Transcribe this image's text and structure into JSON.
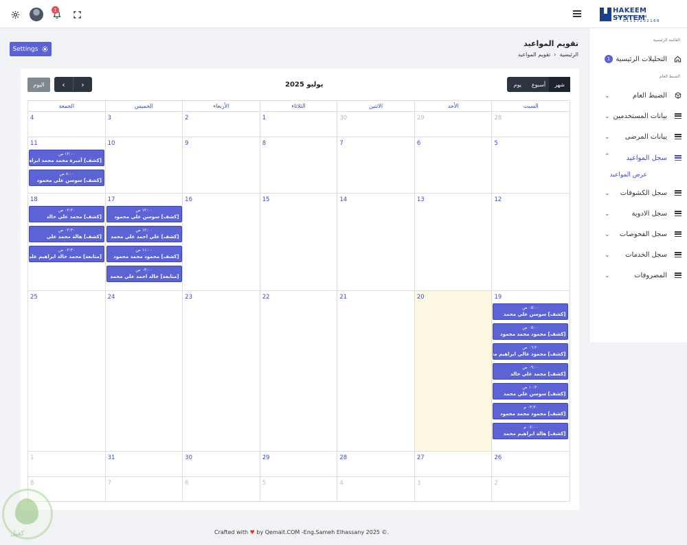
{
  "topbar": {
    "notif_count": "1",
    "logo_title": "HAKEEM SYSTEM",
    "logo_sub": "QEMAIT.COM",
    "logo_phone": "01117202166"
  },
  "sidebar": {
    "section_main": "القائمة الرئيسية",
    "dashboard_label": "التحليلات الرئيسية",
    "dashboard_badge": "1",
    "section_settings": "الضبط العام",
    "items": [
      {
        "label": "الضبط العام"
      },
      {
        "label": "بيانات المستخدمين"
      },
      {
        "label": "بيانات المرضى"
      },
      {
        "label": "سجل المواعيد"
      },
      {
        "label": "سجل الكشوفات"
      },
      {
        "label": "سجل الادوية"
      },
      {
        "label": "سجل الفحوصات"
      },
      {
        "label": "سجل الخدمات"
      },
      {
        "label": "المصروفات"
      }
    ],
    "sub_item": "عرض المواعيد"
  },
  "page": {
    "settings_label": "Settings",
    "title": "تقويم المواعيد",
    "breadcrumb_home": "الرئيسية",
    "breadcrumb_current": "تقويم المواعيد"
  },
  "calendar": {
    "today_label": "اليوم",
    "month_title": "يوليو 2025",
    "view_month": "شهر",
    "view_week": "أسبوع",
    "view_day": "يوم",
    "days_of_week": [
      "الجمعة",
      "الخميس",
      "الأربعاء",
      "الثلاثاء",
      "الاثنين",
      "الأحد",
      "السبت"
    ],
    "weeks": [
      {
        "h": 37,
        "days": [
          {
            "d": "4"
          },
          {
            "d": "3"
          },
          {
            "d": "2"
          },
          {
            "d": "1"
          },
          {
            "d": "30",
            "other": true
          },
          {
            "d": "29",
            "other": true
          },
          {
            "d": "28",
            "other": true
          }
        ]
      },
      {
        "h": 82,
        "days": [
          {
            "d": "11",
            "events": [
              {
                "t": "١٢:٠٠ ص",
                "n": "[كشف] أميرة محمد محمد ابراهيم"
              },
              {
                "t": "٨:٠٠ ص",
                "n": "[كشف] سوسن علي محمود"
              }
            ]
          },
          {
            "d": "10"
          },
          {
            "d": "9"
          },
          {
            "d": "8"
          },
          {
            "d": "7"
          },
          {
            "d": "6"
          },
          {
            "d": "5"
          }
        ]
      },
      {
        "h": 142,
        "days": [
          {
            "d": "18",
            "events": [
              {
                "t": "٠٢:٣٠ ص",
                "n": "[كشف] محمد علي خالد"
              },
              {
                "t": "٠٢:٣٠ ص",
                "n": "[كشف] هالة محمد علي"
              },
              {
                "t": "٠٢:٣٠ ص",
                "n": "[متابعة] محمد خالد ابراهيم علي"
              }
            ]
          },
          {
            "d": "17",
            "events": [
              {
                "t": "١٢:٠٠ ص",
                "n": "[كشف] سوسن علي محمود"
              },
              {
                "t": "١٢:٠٠ ص",
                "n": "[كشف] علي احمد علي محمد"
              },
              {
                "t": "١١:٠٠ ص",
                "n": "[كشف] محمود محمد محمود"
              },
              {
                "t": "٠٣:٠٠ ص",
                "n": "[متابعة] خالد احمد علي محمد"
              }
            ]
          },
          {
            "d": "16"
          },
          {
            "d": "15"
          },
          {
            "d": "14"
          },
          {
            "d": "13"
          },
          {
            "d": "12"
          }
        ]
      },
      {
        "h": 234,
        "days": [
          {
            "d": "25"
          },
          {
            "d": "24"
          },
          {
            "d": "23"
          },
          {
            "d": "22"
          },
          {
            "d": "21"
          },
          {
            "d": "20",
            "today": true
          },
          {
            "d": "19",
            "events": [
              {
                "t": "٠٥:٠٠ ص",
                "n": "[كشف] سوسن علي محمد"
              },
              {
                "t": "٠٥:٠٠ ص",
                "n": "[كشف] محمود محمد محمود"
              },
              {
                "t": "٠٦:٣٠ ص",
                "n": "[كشف] محمود غالي ابراهيم محمد"
              },
              {
                "t": "٠٩:٠٠ ص",
                "n": "[كشف] محمد علي خالد"
              },
              {
                "t": "١٠:٣٠ ص",
                "n": "[كشف] سوسن علي محمد"
              },
              {
                "t": "٠٣:٣٠ م",
                "n": "[كشف] محمود محمد محمود"
              },
              {
                "t": "٠٤:٠٠ م",
                "n": "[كشف] هالة ابراهيم محمد"
              }
            ]
          }
        ]
      },
      {
        "h": 37,
        "days": [
          {
            "d": "1",
            "other": true
          },
          {
            "d": "31"
          },
          {
            "d": "30"
          },
          {
            "d": "29"
          },
          {
            "d": "28"
          },
          {
            "d": "27"
          },
          {
            "d": "26"
          }
        ]
      },
      {
        "h": 37,
        "days": [
          {
            "d": "8",
            "other": true
          },
          {
            "d": "7",
            "other": true
          },
          {
            "d": "6",
            "other": true
          },
          {
            "d": "5",
            "other": true
          },
          {
            "d": "4",
            "other": true
          },
          {
            "d": "3",
            "other": true
          },
          {
            "d": "2",
            "other": true
          }
        ]
      }
    ]
  },
  "footer": {
    "crafted": "Crafted with",
    "by": "by Qemait.COM -Eng.Sameh Elhassany 2025 ©."
  },
  "watermark_text": "كفيل"
}
